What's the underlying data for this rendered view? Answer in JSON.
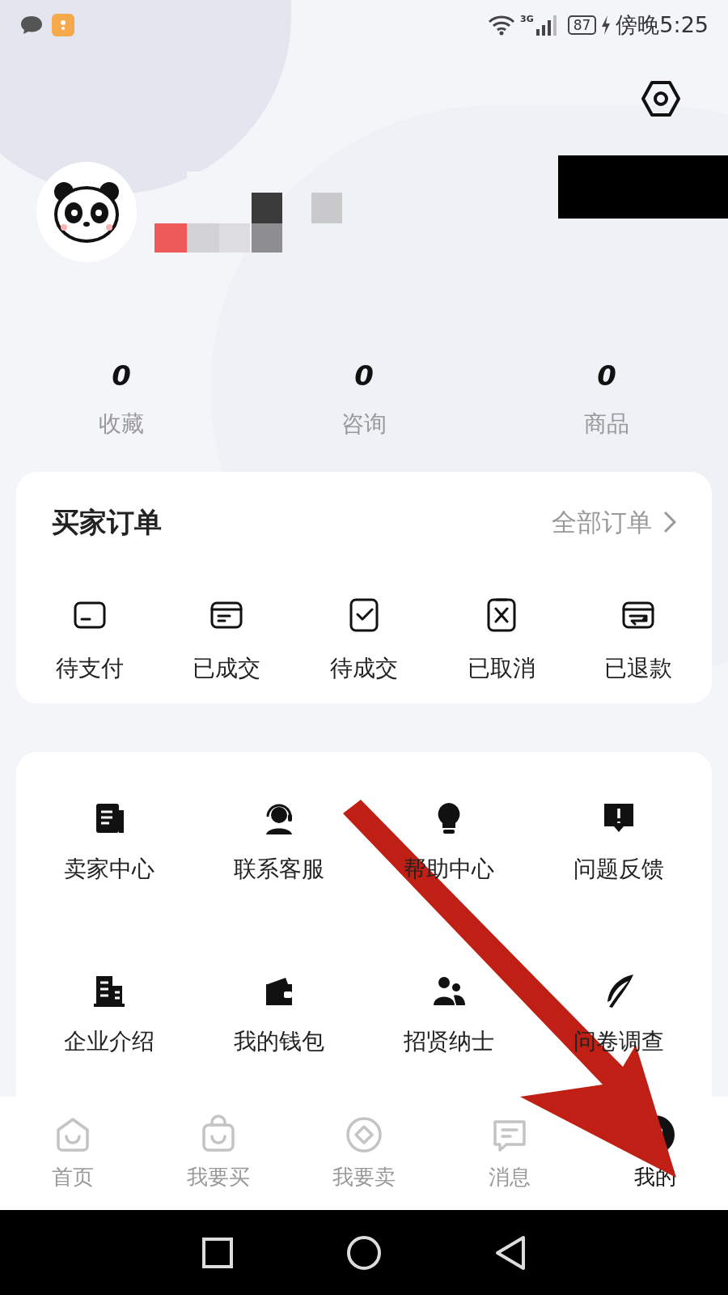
{
  "status_bar": {
    "network": "3G",
    "battery": "87",
    "time": "傍晚5:25"
  },
  "stats": [
    {
      "value": "0",
      "label": "收藏"
    },
    {
      "value": "0",
      "label": "咨询"
    },
    {
      "value": "0",
      "label": "商品"
    }
  ],
  "buyer_orders": {
    "title": "买家订单",
    "all_link": "全部订单",
    "items": [
      "待支付",
      "已成交",
      "待成交",
      "已取消",
      "已退款"
    ]
  },
  "services": [
    "卖家中心",
    "联系客服",
    "帮助中心",
    "问题反馈",
    "企业介绍",
    "我的钱包",
    "招贤纳士",
    "问卷调查"
  ],
  "tab_bar": [
    {
      "label": "首页",
      "selected": false
    },
    {
      "label": "我要买",
      "selected": false
    },
    {
      "label": "我要卖",
      "selected": false
    },
    {
      "label": "消息",
      "selected": false
    },
    {
      "label": "我的",
      "selected": true
    }
  ]
}
